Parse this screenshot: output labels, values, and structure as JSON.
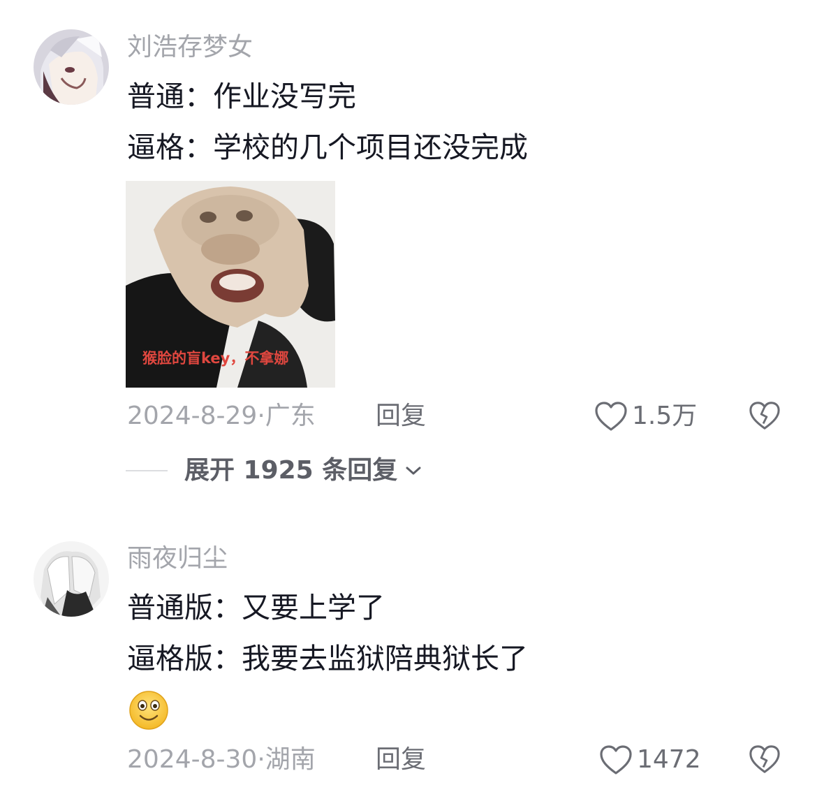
{
  "comments": [
    {
      "username": "刘浩存梦女",
      "lines": [
        "普通：作业没写完",
        "逼格：学校的几个项目还没完成"
      ],
      "image_caption": "猴脸的盲key，不拿娜",
      "date": "2024-8-29",
      "location": "广东",
      "reply_label": "回复",
      "likes": "1.5万",
      "expand_label": "展开 1925 条回复"
    },
    {
      "username": "雨夜归尘",
      "lines": [
        "普通版：又要上学了",
        "逼格版：我要去监狱陪典狱长了"
      ],
      "date": "2024-8-30",
      "location": "湖南",
      "reply_label": "回复",
      "likes": "1472"
    }
  ],
  "separator": "·",
  "icons": {
    "like": "heart-outline-icon",
    "dislike": "broken-heart-icon",
    "expand": "chevron-down-icon",
    "emoji": "smiling-face-emoji-icon"
  },
  "colors": {
    "primary_text": "#161823",
    "secondary_text": "#a3a5ab",
    "action_text": "#6b6d74"
  }
}
